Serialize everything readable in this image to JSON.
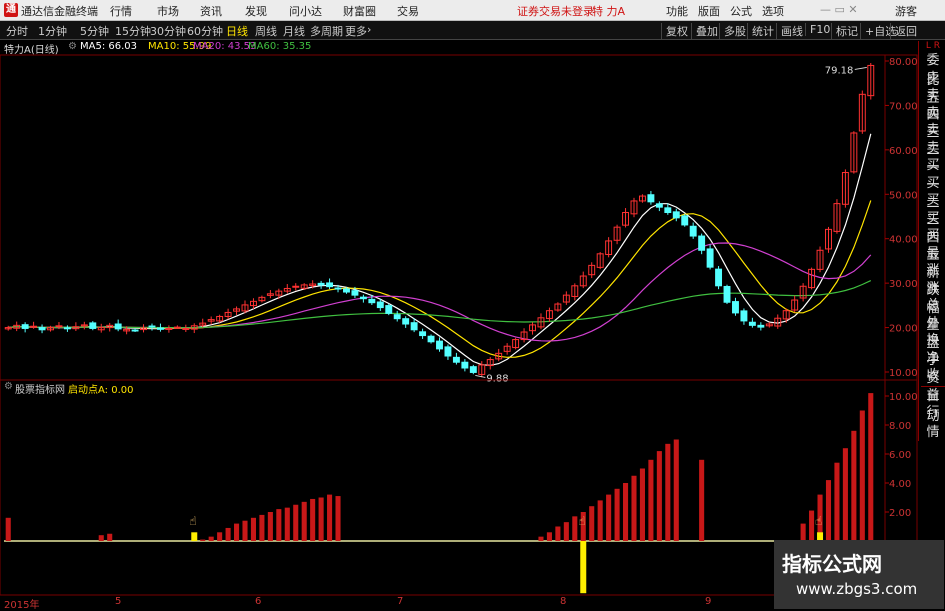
{
  "topbar": {
    "logo_char": "通",
    "brand": "通达信金融终端",
    "menus": [
      "行情",
      "市场",
      "资讯",
      "发现",
      "问小达",
      "财富圈",
      "交易"
    ],
    "warning": "证券交易未登录",
    "stock_name": "特 力A",
    "right_menus": [
      "功能",
      "版面",
      "公式",
      "选项"
    ],
    "guest": "游客"
  },
  "toolbar": {
    "periods": [
      "分时",
      "1分钟",
      "5分钟",
      "15分钟",
      "30分钟",
      "60分钟",
      "日线",
      "周线",
      "月线",
      "多周期",
      "更多"
    ],
    "active_period": "日线",
    "right_buttons": [
      "复权",
      "叠加",
      "多股",
      "统计",
      "画线",
      "F10",
      "标记",
      "+自选",
      "返回"
    ]
  },
  "main_chart": {
    "title": "特力A(日线)",
    "ma": [
      {
        "label": "MA5: 66.03",
        "color": "#ffffff"
      },
      {
        "label": "MA10: 55.99",
        "color": "#ffe400"
      },
      {
        "label": "MA20: 43.53",
        "color": "#d040d0"
      },
      {
        "label": "MA60: 35.35",
        "color": "#40c040"
      }
    ],
    "high_annotation": "79.18",
    "low_annotation": "9.88",
    "y_ticks": [
      "80.00",
      "70.00",
      "60.00",
      "50.00",
      "40.00",
      "30.00",
      "20.00",
      "10.00"
    ]
  },
  "right_panel": {
    "items": [
      "委比",
      "卖五",
      "卖四",
      "卖三",
      "卖二",
      "卖一",
      "买一",
      "买二",
      "买三",
      "买四",
      "买五",
      "最新",
      "涨跌",
      "涨幅",
      "总量",
      "外盘",
      "换手",
      "净资",
      "收益"
    ],
    "bottom_tab": [
      "自动",
      "行情"
    ]
  },
  "sub_chart": {
    "title": "股票指标网",
    "indicator": "启动点A: 0.00",
    "y_ticks": [
      "10.00",
      "8.00",
      "6.00",
      "4.00",
      "2.00"
    ]
  },
  "x_labels": [
    "2015年",
    "5",
    "6",
    "7",
    "8",
    "9"
  ],
  "watermark": {
    "line1": "指标公式网",
    "line2": "www.zbgs3.com"
  },
  "chart_data": {
    "type": "candlestick_with_indicator",
    "price_ylim": [
      10,
      80
    ],
    "candles_close": [
      20,
      20.5,
      19.8,
      20.3,
      19.5,
      20,
      20.4,
      19.9,
      20.2,
      20.6,
      19.8,
      20,
      20.5,
      19.7,
      19.6,
      19.4,
      19.9,
      20.2,
      19.6,
      19.8,
      20.1,
      19.8,
      20.4,
      21,
      21.8,
      22.5,
      23.4,
      24.2,
      25.1,
      25.9,
      26.8,
      27.6,
      28.2,
      28.8,
      29.3,
      29.6,
      29.8,
      29.6,
      29.2,
      28.7,
      28.0,
      27.3,
      26.5,
      25.6,
      24.5,
      23.2,
      22.0,
      20.8,
      19.5,
      18.2,
      16.8,
      15.2,
      13.6,
      12.2,
      10.9,
      9.9,
      11.6,
      12.8,
      14.2,
      15.8,
      17.3,
      19.0,
      20.6,
      22.2,
      23.8,
      25.3,
      27.3,
      29.4,
      31.6,
      34.0,
      36.6,
      39.5,
      42.6,
      45.9,
      48.5,
      49.6,
      48.3,
      47.1,
      45.9,
      44.7,
      43.1,
      40.6,
      37.4,
      33.6,
      29.4,
      25.7,
      23.3,
      21.5,
      20.5,
      20.1,
      20.8,
      22.1,
      23.8,
      26.2,
      29.3,
      33.1,
      37.4,
      42.1,
      47.9,
      54.9,
      63.8,
      72.5,
      79.0
    ],
    "indicator_values_bars": [
      1.6,
      0,
      0,
      0,
      0,
      0,
      0,
      0,
      0,
      0,
      0,
      0.4,
      0.5,
      0,
      0,
      0,
      0,
      0,
      0,
      0,
      0,
      0,
      0,
      0.1,
      0.3,
      0.6,
      0.9,
      1.2,
      1.4,
      1.6,
      1.8,
      2.0,
      2.2,
      2.3,
      2.5,
      2.7,
      2.9,
      3.0,
      3.2,
      3.1,
      0,
      0,
      0,
      0,
      0,
      0,
      0,
      0,
      0,
      0,
      0,
      0,
      0,
      0,
      0,
      0,
      0,
      0,
      0,
      0,
      0,
      0,
      0,
      0.3,
      0.6,
      1.0,
      1.3,
      1.7,
      2.0,
      2.4,
      2.8,
      3.2,
      3.6,
      4.0,
      4.5,
      5.0,
      5.6,
      6.2,
      6.7,
      7.0,
      0,
      0,
      5.6,
      0,
      0,
      0,
      0,
      0,
      0,
      0,
      0,
      0,
      0,
      0,
      1.2,
      2.1,
      3.2,
      4.2,
      5.4,
      6.4,
      7.6,
      9.0,
      10.2
    ],
    "signal_points": [
      {
        "x": "2015-05",
        "value": 0.6
      },
      {
        "x": "2015-07",
        "value": -3.6
      },
      {
        "x": "2015-09",
        "value": 0.6
      }
    ]
  }
}
